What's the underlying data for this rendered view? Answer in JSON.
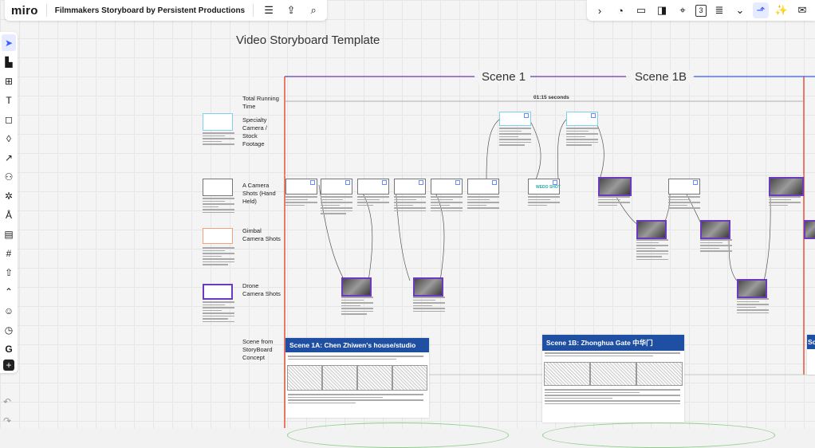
{
  "app": {
    "logo": "miro",
    "board_title": "Filmmakers Storyboard by Persistent Productions"
  },
  "toolbar_left": [
    {
      "id": "menu",
      "glyph": "☰"
    },
    {
      "id": "share",
      "glyph": "⇪"
    },
    {
      "id": "search",
      "glyph": "⌕"
    }
  ],
  "toolbar_right": [
    {
      "id": "expand",
      "glyph": "›"
    },
    {
      "id": "timer",
      "glyph": "◔"
    },
    {
      "id": "video",
      "glyph": "▭"
    },
    {
      "id": "screen-share",
      "glyph": "◨"
    },
    {
      "id": "focus",
      "glyph": "⌖"
    },
    {
      "id": "number",
      "glyph": "3"
    },
    {
      "id": "notes",
      "glyph": "≣"
    },
    {
      "id": "more",
      "glyph": "⌄"
    },
    {
      "id": "present",
      "glyph": "⬏"
    },
    {
      "id": "celebrate",
      "glyph": "✨"
    },
    {
      "id": "comments",
      "glyph": "✉"
    }
  ],
  "sidebar": [
    {
      "id": "select",
      "glyph": "➤"
    },
    {
      "id": "templates",
      "glyph": "▙"
    },
    {
      "id": "table",
      "glyph": "⊞"
    },
    {
      "id": "text",
      "glyph": "T"
    },
    {
      "id": "sticky-note",
      "glyph": "◻"
    },
    {
      "id": "shapes",
      "glyph": "◊"
    },
    {
      "id": "connection-line",
      "glyph": "↗"
    },
    {
      "id": "mind-map",
      "glyph": "⚇"
    },
    {
      "id": "diagram",
      "glyph": "✲"
    },
    {
      "id": "pen",
      "glyph": "Å"
    },
    {
      "id": "comment",
      "glyph": "▤"
    },
    {
      "id": "frame",
      "glyph": "#"
    },
    {
      "id": "upload",
      "glyph": "⇧"
    },
    {
      "id": "apps",
      "glyph": "⌃"
    },
    {
      "id": "emoji",
      "glyph": "☺"
    },
    {
      "id": "timer-tool",
      "glyph": "◷"
    },
    {
      "id": "google",
      "glyph": "G"
    },
    {
      "id": "add",
      "glyph": "+"
    }
  ],
  "undo": "↶",
  "redo": "↷",
  "canvas": {
    "template_title": "Video Storyboard Template",
    "scene1": "Scene 1",
    "scene1b": "Scene 1B",
    "running_time": "01:15 seconds",
    "wedo": "WEDO SHOT",
    "row_labels": {
      "total": "Total Running Time",
      "specialty": "Specialty Camera / Stock Footage",
      "a_camera": "A Camera Shots (Hand Held)",
      "gimbal": "Gimbal Camera Shots",
      "drone": "Drone Camera Shots",
      "scene_concept": "Scene from StoryBoard Concept"
    },
    "scene_cards": [
      {
        "title": "Scene 1A: Chen Zhiwen's house/studio"
      },
      {
        "title": "Scene 1B: Zhonghua Gate 中华门"
      },
      {
        "title": "Sc"
      }
    ]
  },
  "colors": {
    "accent": "#3a5bff",
    "scene_line": "#e2533b",
    "scene_blue": "#1f4fa3"
  }
}
